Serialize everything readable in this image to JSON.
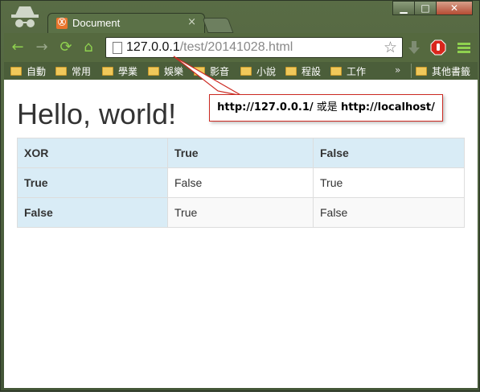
{
  "window": {
    "tab_title": "Document",
    "tab_close": "×",
    "controls": {
      "minimize": "▁",
      "maximize": "□",
      "close": "✕"
    }
  },
  "toolbar": {
    "back": "←",
    "forward": "→",
    "reload": "⟳",
    "home": "⌂",
    "url_host": "127.0.0.1",
    "url_path": "/test/20141028.html",
    "star": "☆"
  },
  "bookmarks": {
    "items": [
      "自動",
      "常用",
      "學業",
      "娛樂",
      "影音",
      "小說",
      "程設",
      "工作"
    ],
    "more": "»",
    "other": "其他書籤"
  },
  "page": {
    "heading": "Hello, world!",
    "table": {
      "header": [
        "XOR",
        "True",
        "False"
      ],
      "rows": [
        [
          "True",
          "False",
          "True"
        ],
        [
          "False",
          "True",
          "False"
        ]
      ]
    }
  },
  "annotation": {
    "part1": "http://127.0.0.1/",
    "part2": " 或是 ",
    "part3": "http://localhost/"
  },
  "colors": {
    "frame": "#4f6340",
    "table_header": "#d9ecf6",
    "callout_border": "#cc2a22"
  }
}
